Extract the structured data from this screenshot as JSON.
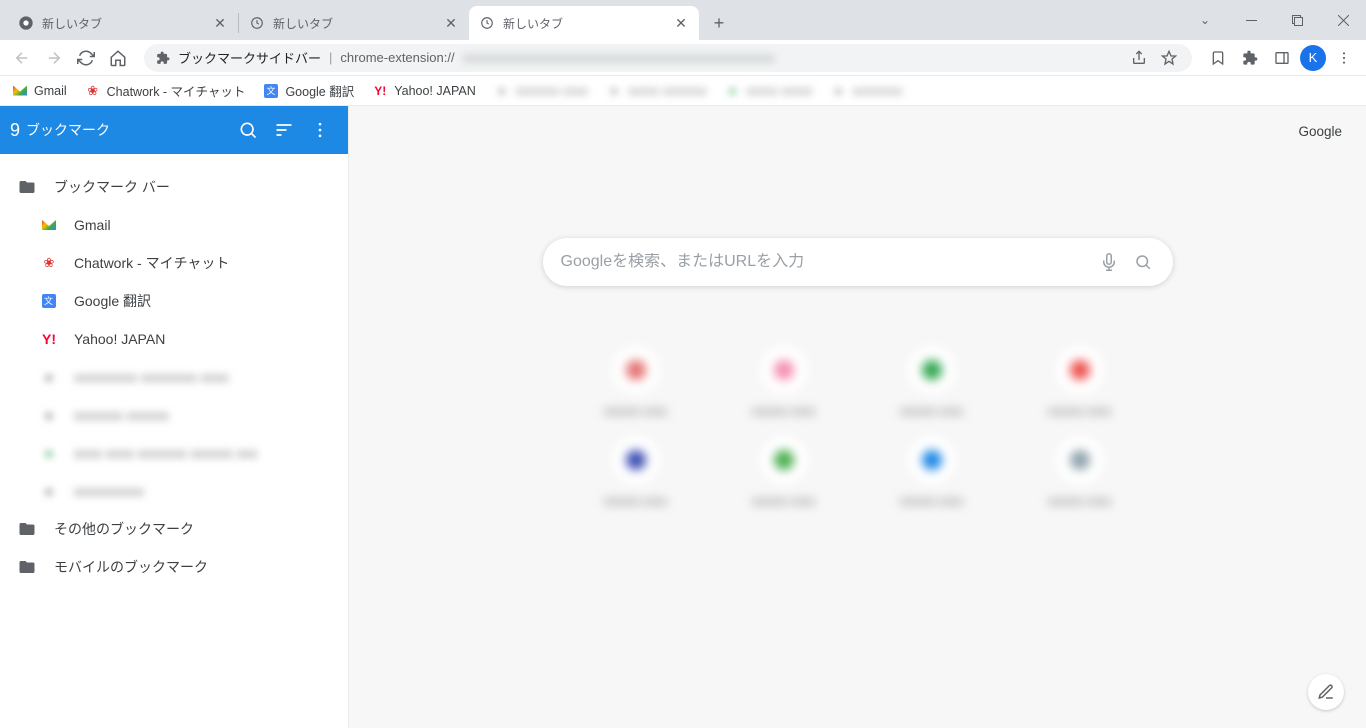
{
  "tabs": [
    {
      "title": "新しいタブ",
      "icon": "chrome"
    },
    {
      "title": "新しいタブ",
      "icon": "clock"
    },
    {
      "title": "新しいタブ",
      "icon": "clock",
      "active": true
    }
  ],
  "omnibox": {
    "page_title": "ブックマークサイドバー",
    "url_prefix": "chrome-extension://"
  },
  "profile_initial": "K",
  "bookmarks_bar": [
    {
      "label": "Gmail",
      "icon": "gmail"
    },
    {
      "label": "Chatwork - マイチャット",
      "icon": "chatwork"
    },
    {
      "label": "Google 翻訳",
      "icon": "gtranslate"
    },
    {
      "label": "Yahoo! JAPAN",
      "icon": "yahoo"
    }
  ],
  "sidebar": {
    "badge": "9",
    "title": "ブックマーク",
    "folders": {
      "bar": "ブックマーク バー",
      "other": "その他のブックマーク",
      "mobile": "モバイルのブックマーク"
    },
    "items": [
      {
        "label": "Gmail",
        "icon": "gmail"
      },
      {
        "label": "Chatwork - マイチャット",
        "icon": "chatwork"
      },
      {
        "label": "Google 翻訳",
        "icon": "gtranslate"
      },
      {
        "label": "Yahoo! JAPAN",
        "icon": "yahoo"
      }
    ]
  },
  "ntp": {
    "top_link": "Google",
    "search_placeholder": "Googleを検索、またはURLを入力",
    "shortcut_colors": [
      "#e57373",
      "#f48fb1",
      "#34a853",
      "#ef5350",
      "#3f51b5",
      "#4caf50",
      "#1e88e5",
      "#90a4ae"
    ]
  }
}
